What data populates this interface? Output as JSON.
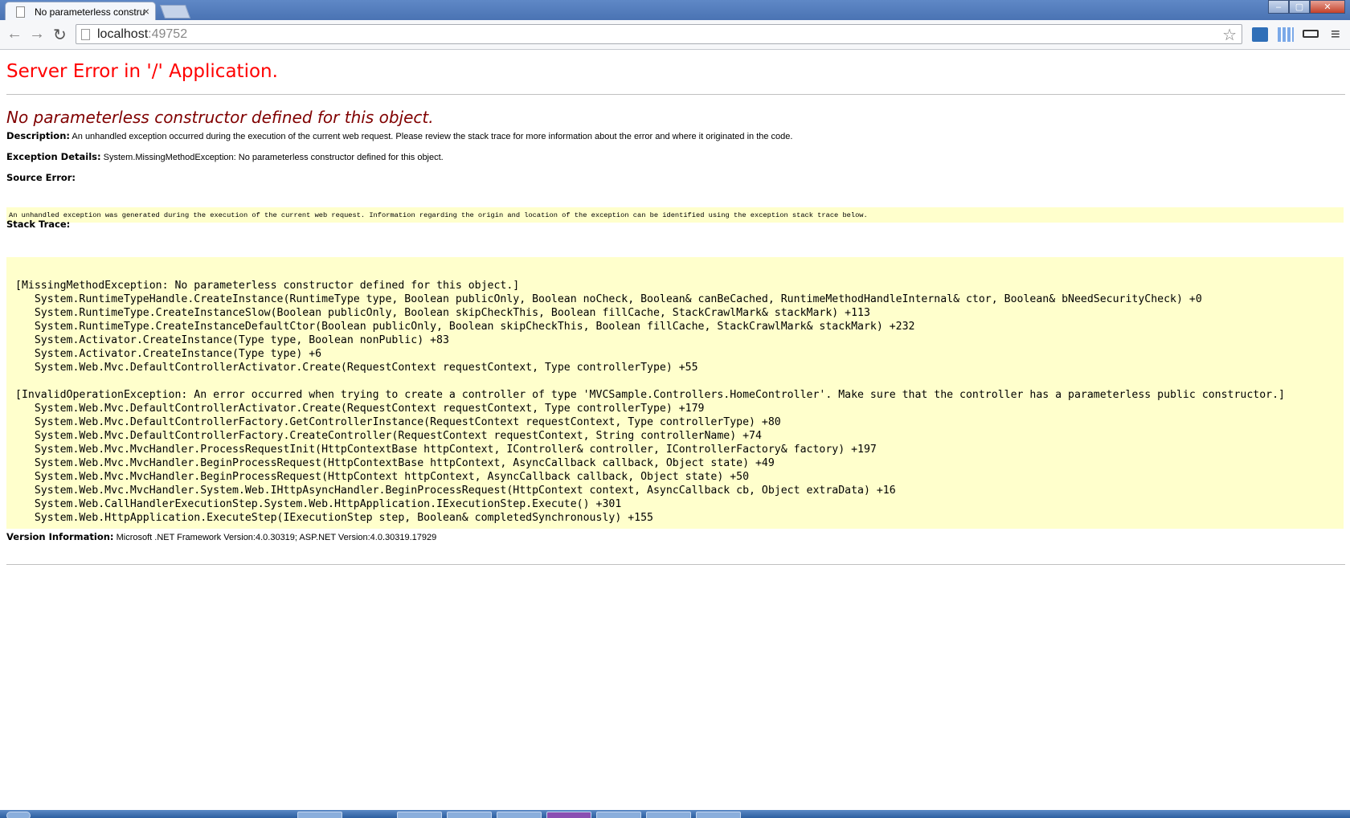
{
  "browser": {
    "tab_title": "No parameterless constru",
    "tab_close": "×",
    "url_host": "localhost",
    "url_port": ":49752",
    "win_min": "–",
    "win_max": "▢",
    "win_close": "✕",
    "back_glyph": "←",
    "forward_glyph": "→",
    "reload_glyph": "↻",
    "star_glyph": "☆",
    "menu_glyph": "≡"
  },
  "error": {
    "heading": "Server Error in '/' Application.",
    "message": "No parameterless constructor defined for this object.",
    "description_label": "Description:",
    "description_text": " An unhandled exception occurred during the execution of the current web request. Please review the stack trace for more information about the error and where it originated in the code.",
    "exception_label": "Exception Details:",
    "exception_text": " System.MissingMethodException: No parameterless constructor defined for this object.",
    "source_label": "Source Error:",
    "source_text": "An unhandled exception was generated during the execution of the current web request. Information regarding the origin and location of the exception can be identified using the exception stack trace below.",
    "stack_label": "Stack Trace:",
    "stack_trace": "[MissingMethodException: No parameterless constructor defined for this object.]\n   System.RuntimeTypeHandle.CreateInstance(RuntimeType type, Boolean publicOnly, Boolean noCheck, Boolean& canBeCached, RuntimeMethodHandleInternal& ctor, Boolean& bNeedSecurityCheck) +0\n   System.RuntimeType.CreateInstanceSlow(Boolean publicOnly, Boolean skipCheckThis, Boolean fillCache, StackCrawlMark& stackMark) +113\n   System.RuntimeType.CreateInstanceDefaultCtor(Boolean publicOnly, Boolean skipCheckThis, Boolean fillCache, StackCrawlMark& stackMark) +232\n   System.Activator.CreateInstance(Type type, Boolean nonPublic) +83\n   System.Activator.CreateInstance(Type type) +6\n   System.Web.Mvc.DefaultControllerActivator.Create(RequestContext requestContext, Type controllerType) +55\n\n[InvalidOperationException: An error occurred when trying to create a controller of type 'MVCSample.Controllers.HomeController'. Make sure that the controller has a parameterless public constructor.]\n   System.Web.Mvc.DefaultControllerActivator.Create(RequestContext requestContext, Type controllerType) +179\n   System.Web.Mvc.DefaultControllerFactory.GetControllerInstance(RequestContext requestContext, Type controllerType) +80\n   System.Web.Mvc.DefaultControllerFactory.CreateController(RequestContext requestContext, String controllerName) +74\n   System.Web.Mvc.MvcHandler.ProcessRequestInit(HttpContextBase httpContext, IController& controller, IControllerFactory& factory) +197\n   System.Web.Mvc.MvcHandler.BeginProcessRequest(HttpContextBase httpContext, AsyncCallback callback, Object state) +49\n   System.Web.Mvc.MvcHandler.BeginProcessRequest(HttpContext httpContext, AsyncCallback callback, Object state) +50\n   System.Web.Mvc.MvcHandler.System.Web.IHttpAsyncHandler.BeginProcessRequest(HttpContext context, AsyncCallback cb, Object extraData) +16\n   System.Web.CallHandlerExecutionStep.System.Web.HttpApplication.IExecutionStep.Execute() +301\n   System.Web.HttpApplication.ExecuteStep(IExecutionStep step, Boolean& completedSynchronously) +155",
    "version_label": "Version Information:",
    "version_text": " Microsoft .NET Framework Version:4.0.30319; ASP.NET Version:4.0.30319.17929"
  },
  "colors": {
    "heading_red": "#ff0000",
    "message_maroon": "#800000",
    "code_background": "#ffffcc"
  }
}
